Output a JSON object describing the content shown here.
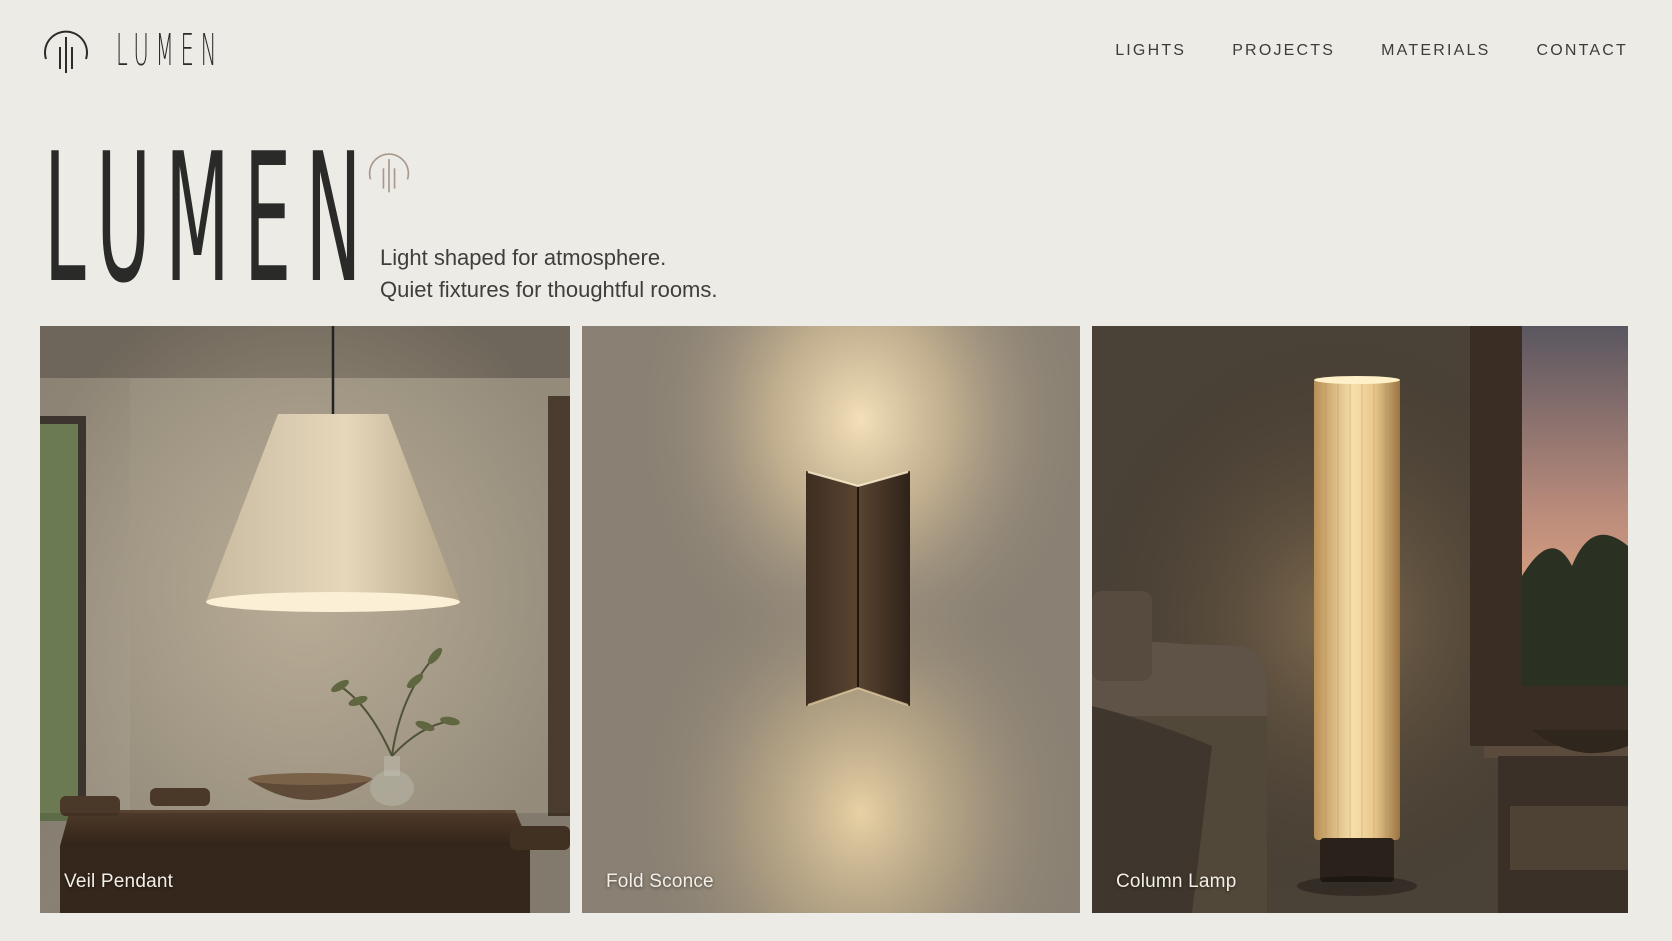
{
  "brand": {
    "name": "LUMEN",
    "logo_icon": "lumen-ring-icon"
  },
  "nav": {
    "items": [
      {
        "label": "LIGHTS"
      },
      {
        "label": "PROJECTS"
      },
      {
        "label": "MATERIALS"
      },
      {
        "label": "CONTACT"
      }
    ]
  },
  "hero": {
    "title": "LUMEN",
    "tagline_line1": "Light shaped for atmosphere.",
    "tagline_line2": "Quiet fixtures for thoughtful rooms."
  },
  "products": [
    {
      "name": "Veil Pendant"
    },
    {
      "name": "Fold Sconce"
    },
    {
      "name": "Column Lamp"
    }
  ],
  "colors": {
    "background": "#edebe6",
    "text": "#2a2a28",
    "accent": "#a8998a"
  }
}
